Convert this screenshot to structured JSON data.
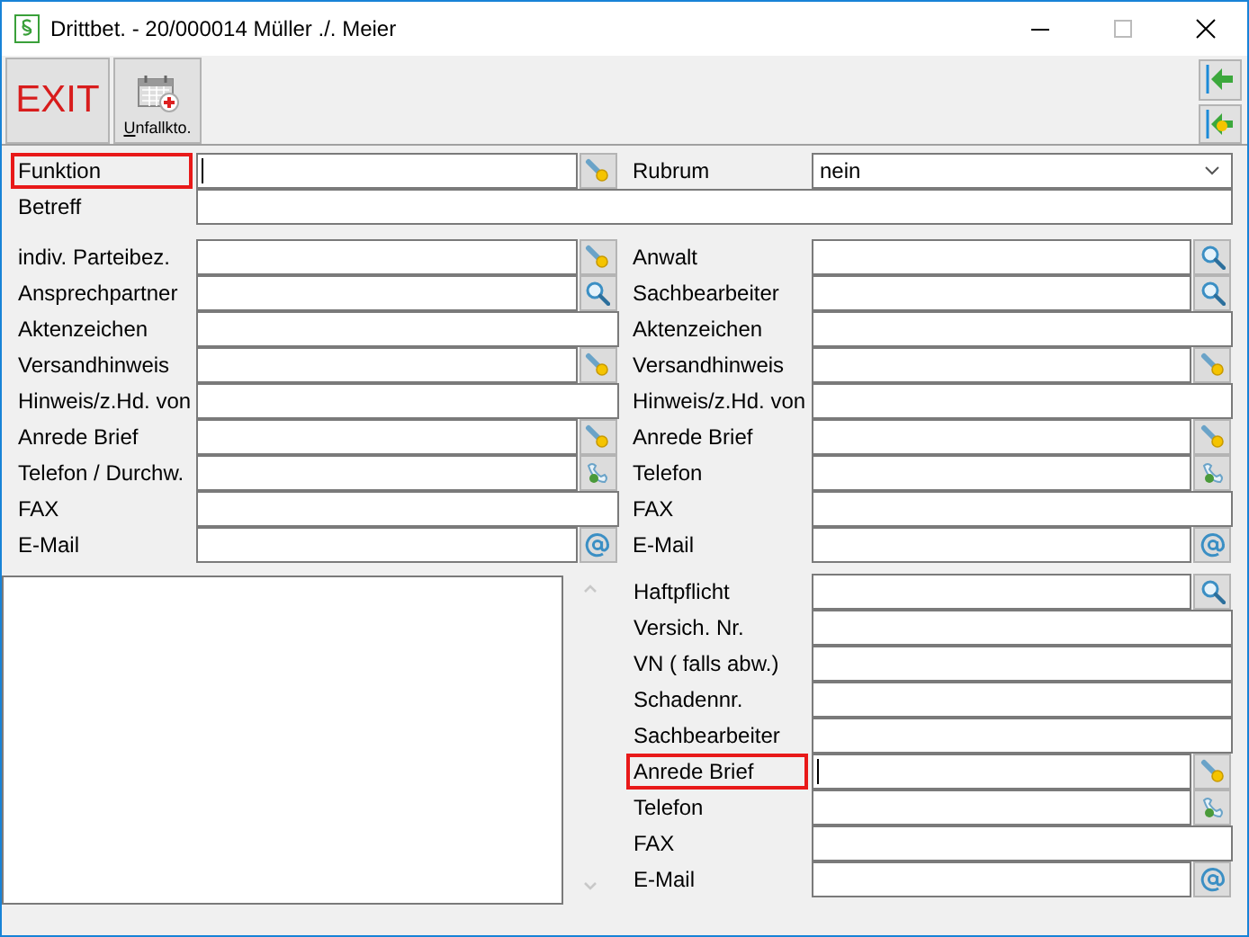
{
  "window": {
    "title": "Drittbet. - 20/000014  Müller ./. Meier"
  },
  "toolbar": {
    "exit": "EXIT",
    "unfall": {
      "label": "Unfallkto."
    }
  },
  "top": {
    "funktion": {
      "label": "Funktion",
      "highlighted": true,
      "cursor": true,
      "kind": "key"
    },
    "rubrum": {
      "label": "Rubrum",
      "value": "nein"
    },
    "betreff": {
      "label": "Betreff"
    }
  },
  "left_rows": [
    {
      "label": "indiv. Parteibez.",
      "kind": "key"
    },
    {
      "label": "Ansprechpartner",
      "kind": "search"
    },
    {
      "label": "Aktenzeichen",
      "kind": "plain"
    },
    {
      "label": "Versandhinweis",
      "kind": "key"
    },
    {
      "label": "Hinweis/z.Hd. von",
      "kind": "plain"
    },
    {
      "label": "Anrede Brief",
      "kind": "key"
    },
    {
      "label": "Telefon / Durchw.",
      "kind": "phone"
    },
    {
      "label": "FAX",
      "kind": "plain"
    },
    {
      "label": "E-Mail",
      "kind": "email"
    }
  ],
  "right_rows": [
    {
      "label": "Anwalt",
      "kind": "search"
    },
    {
      "label": "Sachbearbeiter",
      "kind": "search"
    },
    {
      "label": "Aktenzeichen",
      "kind": "plain"
    },
    {
      "label": "Versandhinweis",
      "kind": "key"
    },
    {
      "label": "Hinweis/z.Hd. von",
      "kind": "plain"
    },
    {
      "label": "Anrede Brief",
      "kind": "key"
    },
    {
      "label": "Telefon",
      "kind": "phone"
    },
    {
      "label": "FAX",
      "kind": "plain"
    },
    {
      "label": "E-Mail",
      "kind": "email"
    }
  ],
  "insurance_rows": [
    {
      "label": "Haftpflicht",
      "kind": "search"
    },
    {
      "label": "Versich. Nr.",
      "kind": "plain"
    },
    {
      "label": "VN ( falls abw.)",
      "kind": "plain"
    },
    {
      "label": "Schadennr.",
      "kind": "plain"
    },
    {
      "label": "Sachbearbeiter",
      "kind": "plain"
    },
    {
      "label": "Anrede Brief",
      "kind": "key",
      "highlighted": true,
      "cursor": true
    },
    {
      "label": "Telefon",
      "kind": "phone"
    },
    {
      "label": "FAX",
      "kind": "plain"
    },
    {
      "label": "E-Mail",
      "kind": "email"
    }
  ]
}
